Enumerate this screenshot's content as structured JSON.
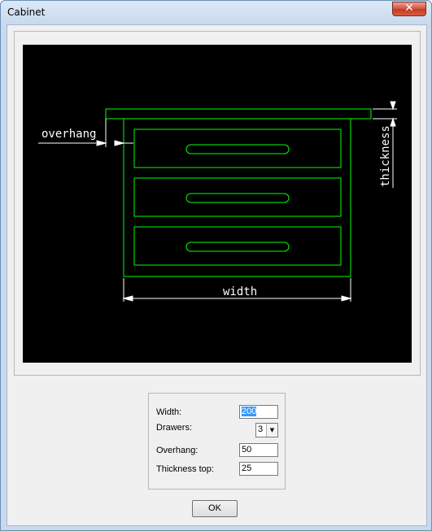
{
  "window": {
    "title": "Cabinet",
    "close_glyph": "✕"
  },
  "preview": {
    "labels": {
      "overhang": "overhang",
      "width": "width",
      "thickness": "thickness"
    },
    "line_color": "#00ff00",
    "dim_color": "#ffffff",
    "background": "#000000"
  },
  "form": {
    "width": {
      "label": "Width:",
      "value": "200"
    },
    "drawers": {
      "label": "Drawers:",
      "value": "3"
    },
    "overhang": {
      "label": "Overhang:",
      "value": "50"
    },
    "thickness_top": {
      "label": "Thickness top:",
      "value": "25"
    }
  },
  "buttons": {
    "ok": "OK"
  }
}
